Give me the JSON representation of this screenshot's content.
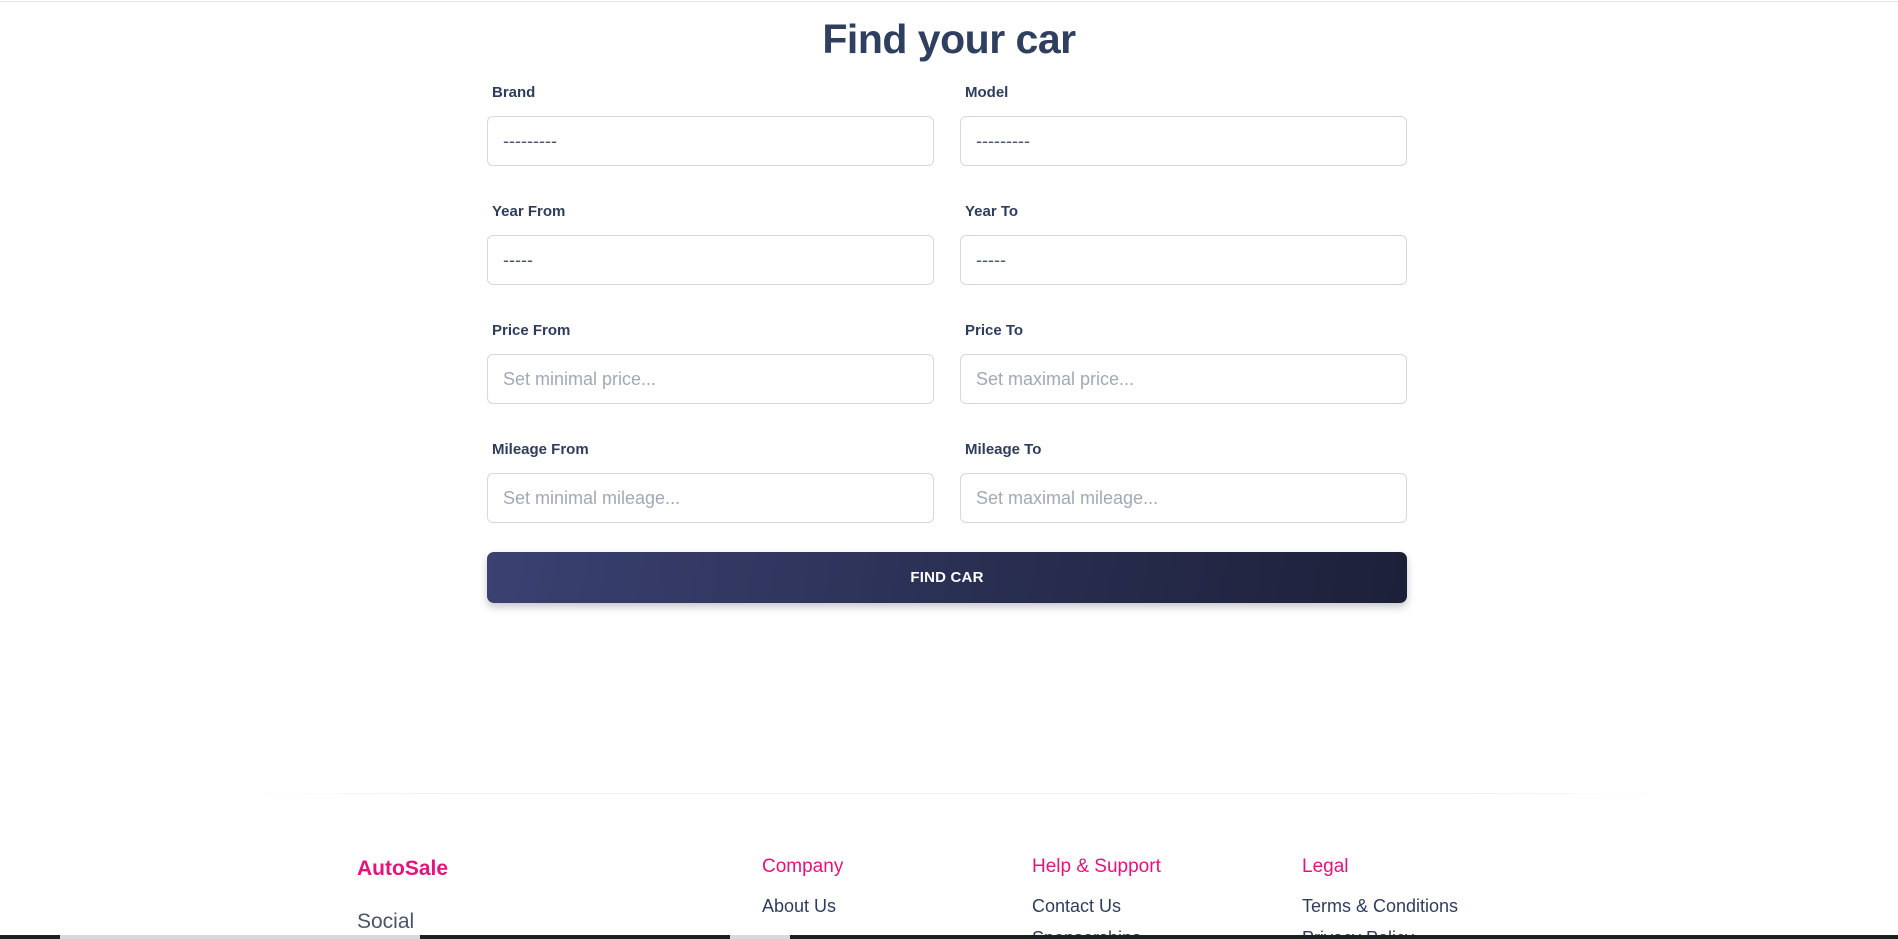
{
  "page": {
    "title": "Find your car"
  },
  "form": {
    "rows": [
      [
        {
          "label": "Brand",
          "value": "---------",
          "placeholder": ""
        },
        {
          "label": "Model",
          "value": "---------",
          "placeholder": ""
        }
      ],
      [
        {
          "label": "Year From",
          "value": "-----",
          "placeholder": ""
        },
        {
          "label": "Year To",
          "value": "-----",
          "placeholder": ""
        }
      ],
      [
        {
          "label": "Price From",
          "value": "",
          "placeholder": "Set minimal price..."
        },
        {
          "label": "Price To",
          "value": "",
          "placeholder": "Set maximal price..."
        }
      ],
      [
        {
          "label": "Mileage From",
          "value": "",
          "placeholder": "Set minimal mileage..."
        },
        {
          "label": "Mileage To",
          "value": "",
          "placeholder": "Set maximal mileage..."
        }
      ]
    ],
    "submit_label": "FIND CAR"
  },
  "footer": {
    "brand": "AutoSale",
    "social_heading": "Social",
    "columns": {
      "company": {
        "heading": "Company",
        "links": [
          "About Us"
        ]
      },
      "help": {
        "heading": "Help & Support",
        "links": [
          "Contact Us",
          "Sponsorships"
        ]
      },
      "legal": {
        "heading": "Legal",
        "links": [
          "Terms & Conditions",
          "Privacy Policy"
        ]
      }
    }
  },
  "colors": {
    "accent": "#e5137a",
    "text_dark": "#2f3d5c",
    "button_start": "#3b4171",
    "button_end": "#1d2039"
  }
}
